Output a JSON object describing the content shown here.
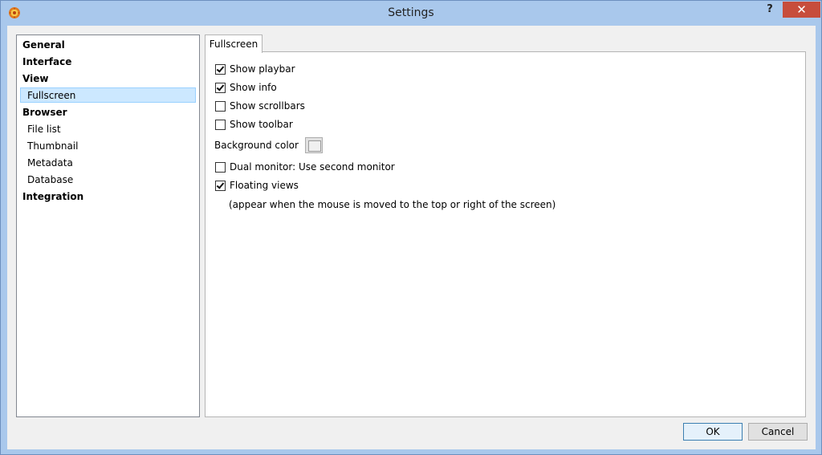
{
  "window": {
    "title": "Settings",
    "help_label": "?",
    "close_label": "✕"
  },
  "nav": {
    "items": [
      {
        "label": "General",
        "level": 0,
        "selected": false
      },
      {
        "label": "Interface",
        "level": 0,
        "selected": false
      },
      {
        "label": "View",
        "level": 0,
        "selected": false
      },
      {
        "label": "Fullscreen",
        "level": 1,
        "selected": true
      },
      {
        "label": "Browser",
        "level": 0,
        "selected": false
      },
      {
        "label": "File list",
        "level": 1,
        "selected": false
      },
      {
        "label": "Thumbnail",
        "level": 1,
        "selected": false
      },
      {
        "label": "Metadata",
        "level": 1,
        "selected": false
      },
      {
        "label": "Database",
        "level": 1,
        "selected": false
      },
      {
        "label": "Integration",
        "level": 0,
        "selected": false
      }
    ]
  },
  "tab": {
    "label": "Fullscreen"
  },
  "options": {
    "show_playbar": {
      "label": "Show playbar",
      "checked": true
    },
    "show_info": {
      "label": "Show info",
      "checked": true
    },
    "show_scrollbars": {
      "label": "Show scrollbars",
      "checked": false
    },
    "show_toolbar": {
      "label": "Show toolbar",
      "checked": false
    },
    "background_color": {
      "label": "Background color",
      "value": "#f0f0f0"
    },
    "dual_monitor": {
      "label": "Dual monitor: Use second monitor",
      "checked": false
    },
    "floating_views": {
      "label": "Floating views",
      "checked": true
    },
    "floating_views_note": "(appear when the mouse is moved to the top or right of the screen)"
  },
  "buttons": {
    "ok_label": "OK",
    "cancel_label": "Cancel"
  },
  "colors": {
    "frame": "#a9c8ec",
    "close": "#c74d3c",
    "selection": "#cce8ff"
  }
}
